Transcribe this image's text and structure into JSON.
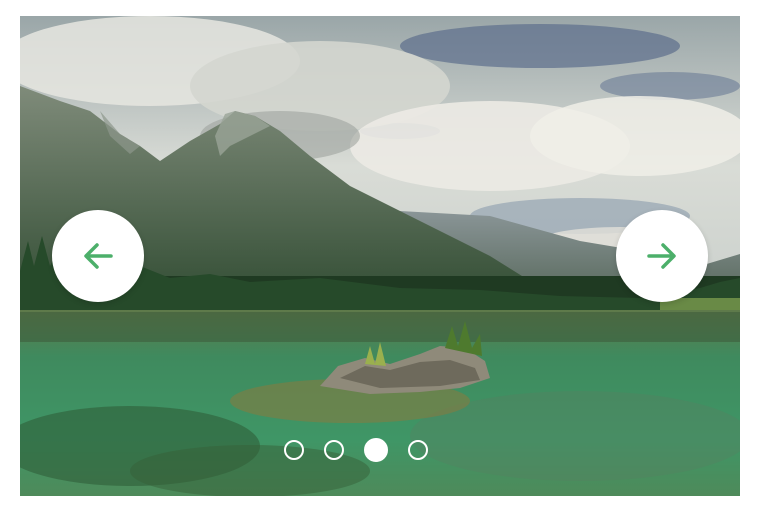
{
  "carousel": {
    "slide_count": 4,
    "active_index": 2,
    "dots": [
      {
        "active": false
      },
      {
        "active": false
      },
      {
        "active": true
      },
      {
        "active": false
      }
    ]
  },
  "icons": {
    "prev": "arrow-left-icon",
    "next": "arrow-right-icon"
  },
  "colors": {
    "accent": "#4caf6a",
    "button_bg": "#ffffff",
    "dot": "#ffffff"
  }
}
